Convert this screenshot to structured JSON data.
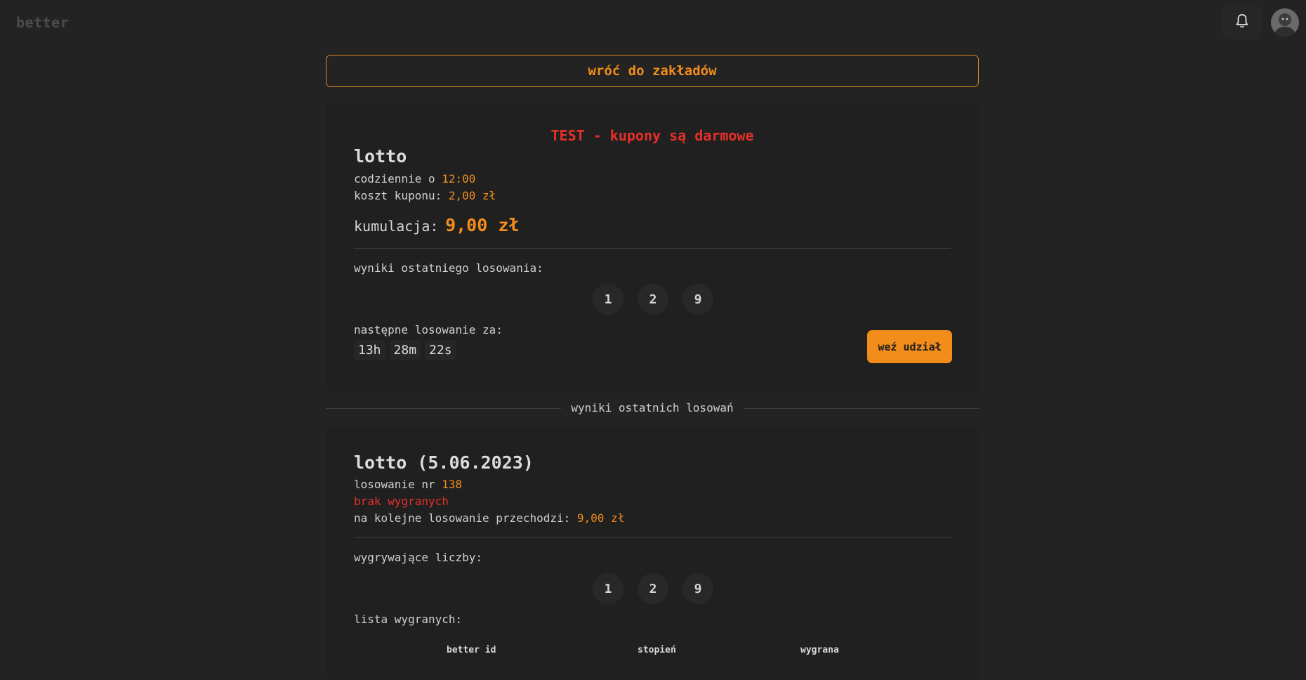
{
  "header": {
    "brand": "better",
    "bell_icon": "bell-icon",
    "avatar_icon": "user-avatar"
  },
  "back_button": {
    "label": "wróć do zakładów"
  },
  "current_game": {
    "test_banner": "TEST - kupony są darmowe",
    "title": "lotto",
    "schedule_prefix": "codziennie o",
    "schedule_time": "12:00",
    "cost_label": "koszt kuponu:",
    "cost_value": "2,00 zł",
    "jackpot_label": "kumulacja:",
    "jackpot_value": "9,00 zł",
    "last_results_label": "wyniki ostatniego losowania:",
    "last_results": [
      "1",
      "2",
      "9"
    ],
    "next_draw_label": "następne losowanie za:",
    "countdown": {
      "hours": "13h",
      "minutes": "28m",
      "seconds": "22s"
    },
    "join_button": "weź udział"
  },
  "history_section": {
    "label": "wyniki ostatnich losowań"
  },
  "past_draw": {
    "title": "lotto (5.06.2023)",
    "draw_no_label": "losowanie nr",
    "draw_no": "138",
    "no_winners": "brak wygranych",
    "carryover_label": "na kolejne losowanie przechodzi:",
    "carryover_value": "9,00 zł",
    "winning_numbers_label": "wygrywające liczby:",
    "winning_numbers": [
      "1",
      "2",
      "9"
    ],
    "winners_list_label": "lista wygranych:",
    "table_headers": [
      "better id",
      "stopień",
      "wygrana"
    ]
  },
  "colors": {
    "accent": "#f28c1b",
    "danger": "#e5302a",
    "background": "#232323",
    "card": "#202020"
  }
}
